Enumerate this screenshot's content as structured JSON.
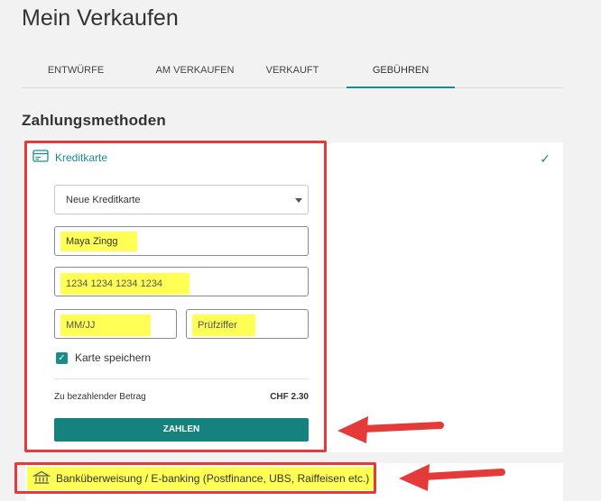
{
  "page_title": "Mein Verkaufen",
  "tabs": [
    {
      "label": "ENTWÜRFE",
      "active": false
    },
    {
      "label": "AM VERKAUFEN",
      "active": false
    },
    {
      "label": "VERKAUFT",
      "active": false
    },
    {
      "label": "GEBÜHREN",
      "active": true
    }
  ],
  "section_title": "Zahlungsmethoden",
  "credit_card": {
    "label": "Kreditkarte",
    "icon": "credit-card-icon",
    "selected": true,
    "card_select": "Neue Kreditkarte",
    "name_value": "Maya Zingg",
    "number_placeholder": "1234 1234 1234 1234",
    "expiry_placeholder": "MM/JJ",
    "cvc_placeholder": "Prüfziffer",
    "save_label": "Karte speichern",
    "save_checked": true,
    "amount_label": "Zu bezahlender Betrag",
    "amount_value": "CHF 2.30",
    "pay_label": "ZAHLEN"
  },
  "bank_transfer": {
    "label": "Banküberweisung / E-banking (Postfinance, UBS, Raiffeisen etc.)",
    "icon": "bank-icon"
  },
  "colors": {
    "accent": "#1b8d88",
    "highlight": "#ffff55",
    "annotation": "#e43a3a"
  }
}
